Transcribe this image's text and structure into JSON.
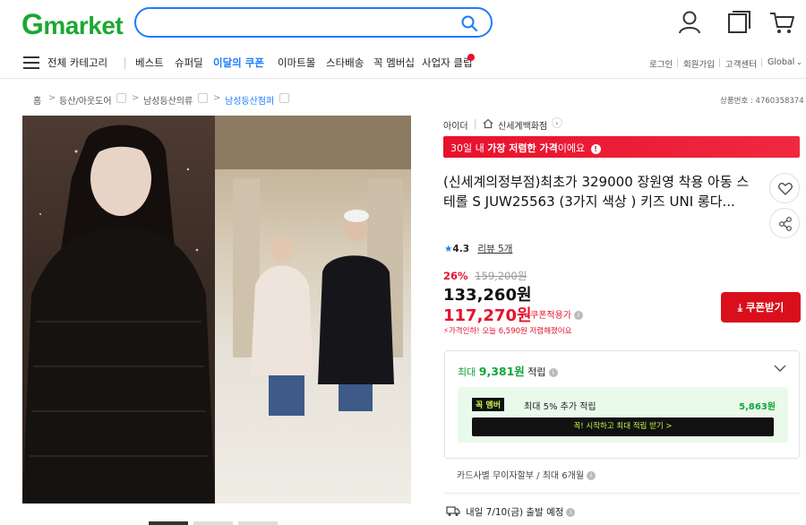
{
  "header": {
    "logo_g": "G",
    "logo_rest": "market",
    "search_placeholder": "",
    "icons": [
      "search-icon",
      "user-icon",
      "recent-items-icon",
      "cart-icon"
    ]
  },
  "nav": {
    "all_categories": "전체 카테고리",
    "items": [
      "베스트",
      "슈퍼딜",
      "이달의 쿠폰",
      "이마트몰",
      "스타배송",
      "꼭 멤버십",
      "사업자 클럽"
    ],
    "right": [
      "로그인",
      "회원가입",
      "고객센터",
      "Global"
    ],
    "active_color": "#1f7bff"
  },
  "breadcrumb": [
    "홈",
    "등산/아웃도어",
    "남성등산의류",
    "남성등산점퍼"
  ],
  "product_number": "상품번호 : 4760358374",
  "seller": {
    "name": "아이더",
    "store": "신세계백화점"
  },
  "banner": {
    "prefix": "30일 내 ",
    "highlight": "가장 저렴한 가격",
    "suffix": "이에요"
  },
  "product": {
    "title": "(신세계의정부점)최초가 329000 장원영 착용 아동 스테롤 S JUW25563 (3가지 색상 ) 키즈 UNI 롱다..."
  },
  "rating": {
    "score": "4.3",
    "reviews_label": "리뷰 5개"
  },
  "price": {
    "discount_rate": "26%",
    "original": "159,200원",
    "sale": "133,260원",
    "coupon_price": "117,270원",
    "coupon_label": "쿠폰적용가",
    "coupon_button": "쿠폰받기",
    "lowest_notice": "가격인하! 오늘 6,590원 저렴해졌어요"
  },
  "points": {
    "label_prefix": "최대 ",
    "amount": "9,381원",
    "label_suffix": " 적립",
    "member_tag": "꼭 멤버",
    "member_text": "최대 5% 추가 적립",
    "member_amount": "5,863원",
    "member_button": "꼭! 시작하고 최대 적립 받기 >"
  },
  "installment": "카드사별 무이자할부 / 최대 6개월",
  "shipping": "내일 7/10(금) 출발 예정",
  "colors": {
    "brand_green": "#1aa832",
    "accent_blue": "#1f7bff",
    "sale_red": "#e8112d",
    "points_green": "#12a53a"
  }
}
